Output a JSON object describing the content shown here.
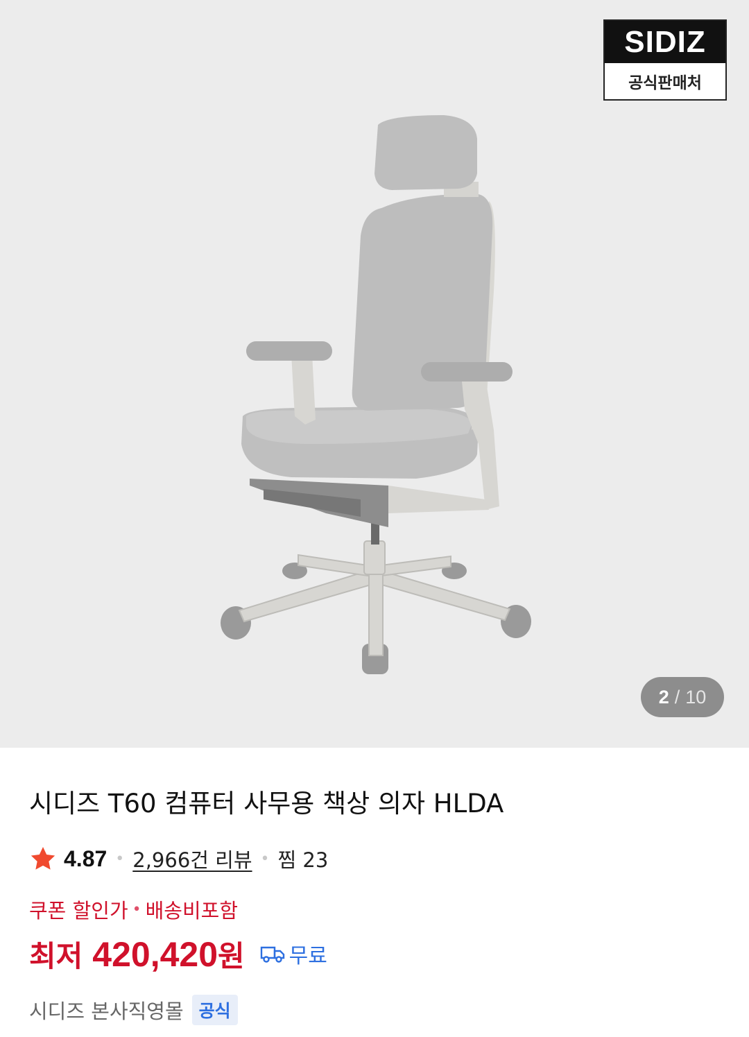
{
  "gallery": {
    "brand_name": "SIDIZ",
    "brand_subtitle": "공식판매처",
    "current_index": "2",
    "separator": "/",
    "total": "10"
  },
  "product": {
    "title": "시디즈 T60 컴퓨터 사무용 책상 의자 HLDA",
    "rating": "4.87",
    "reviews": "2,966건 리뷰",
    "wishlist": "찜 23",
    "coupon_label": "쿠폰 할인가",
    "shipping_note": "배송비포함",
    "price_prefix": "최저",
    "price": "420,420",
    "price_unit": "원",
    "shipping": "무료",
    "seller": "시디즈 본사직영몰",
    "seller_badge": "공식"
  },
  "colors": {
    "accent_red": "#d0112b",
    "accent_blue": "#2d6fe0",
    "star": "#f04a2f",
    "gallery_bg": "#ececec"
  },
  "icons": [
    "star-icon",
    "delivery-truck-icon"
  ]
}
